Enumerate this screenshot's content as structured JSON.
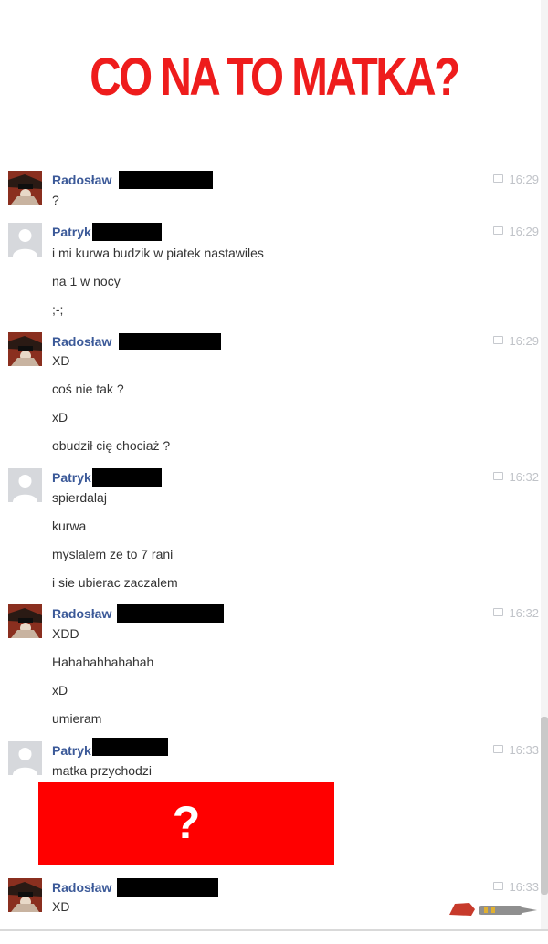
{
  "headline": "CO NA TO MATKA?",
  "groups": [
    {
      "sender": "Radosław",
      "avatar": "radoslaw-avatar",
      "time": "16:29",
      "messages": [
        "?"
      ]
    },
    {
      "sender": "Patryk",
      "avatar": "patryk-avatar",
      "time": "16:29",
      "messages": [
        "i mi kurwa budzik w piatek nastawiles",
        "na 1 w nocy",
        ";-;"
      ]
    },
    {
      "sender": "Radosław",
      "avatar": "radoslaw-avatar",
      "time": "16:29",
      "messages": [
        "XD",
        "coś nie tak ?",
        "xD",
        "obudził cię chociaż ?"
      ]
    },
    {
      "sender": "Patryk",
      "avatar": "patryk-avatar",
      "time": "16:32",
      "messages": [
        "spierdalaj",
        "kurwa",
        "myslalem ze to 7 rani",
        "i sie ubierac zaczalem"
      ]
    },
    {
      "sender": "Radosław",
      "avatar": "radoslaw-avatar",
      "time": "16:32",
      "messages": [
        "XDD",
        "Hahahahhahahah",
        "xD",
        "umieram"
      ]
    },
    {
      "sender": "Patryk",
      "avatar": "patryk-avatar",
      "time": "16:33",
      "messages": [
        "matka przychodzi"
      ]
    },
    {
      "sender": "Radosław",
      "avatar": "radoslaw-avatar",
      "time": "16:33",
      "messages": [
        "XD"
      ]
    }
  ],
  "overlay_text": "?",
  "colors": {
    "headline": "#ee1c1c",
    "sender": "#3b5998",
    "redaction": "#000000",
    "overlay": "#ff0000"
  },
  "icons": {
    "timestamp": "chat-bubble-icon"
  }
}
